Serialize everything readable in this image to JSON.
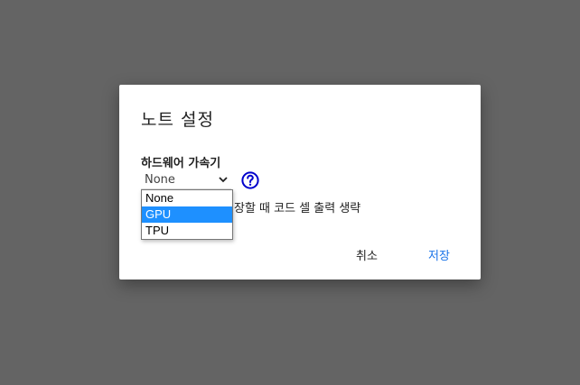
{
  "dialog": {
    "title": "노트 설정",
    "hardware_label": "하드웨어 가속기",
    "accelerator": {
      "selected": "None",
      "options": [
        "None",
        "GPU",
        "TPU"
      ],
      "highlighted": "GPU"
    },
    "help_icon": "question-circle-icon",
    "omit_output_label": "장할 때 코드 셀 출력 생략",
    "cancel_label": "취소",
    "save_label": "저장"
  },
  "colors": {
    "overlay": "#646464",
    "accent": "#1a73e8",
    "help_icon": "#0000cc",
    "highlight": "#1e90ff"
  }
}
